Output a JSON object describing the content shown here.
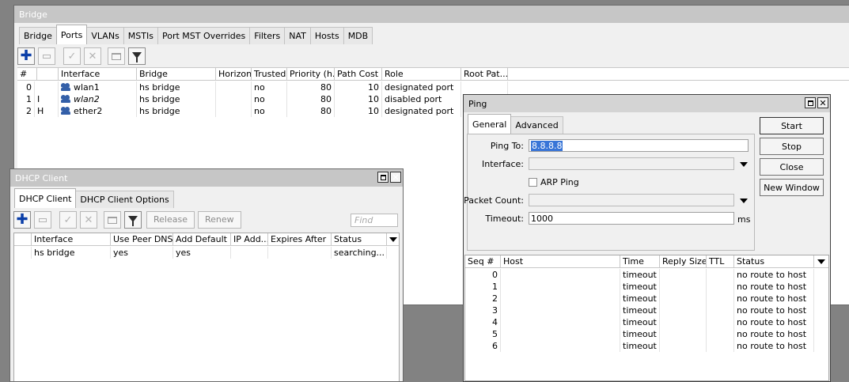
{
  "bridge_window": {
    "title": "Bridge",
    "tabs": [
      {
        "label": "Bridge"
      },
      {
        "label": "Ports"
      },
      {
        "label": "VLANs"
      },
      {
        "label": "MSTIs"
      },
      {
        "label": "Port MST Overrides"
      },
      {
        "label": "Filters"
      },
      {
        "label": "NAT"
      },
      {
        "label": "Hosts"
      },
      {
        "label": "MDB"
      }
    ],
    "selected_tab": "Ports",
    "toolbar": [
      {
        "icon": "plus-icon",
        "enabled": true
      },
      {
        "icon": "minus-icon",
        "enabled": false
      },
      {
        "icon": "check-icon",
        "enabled": false
      },
      {
        "icon": "cross-icon",
        "enabled": false
      },
      {
        "icon": "note-icon",
        "enabled": false
      },
      {
        "icon": "filter-icon",
        "enabled": true
      }
    ],
    "columns": [
      "#",
      "Interface",
      "Bridge",
      "Horizon",
      "Trusted",
      "Priority (h...",
      "Path Cost",
      "Role",
      "Root Pat..."
    ],
    "rows": [
      {
        "num": "0",
        "flag": "",
        "interface": "wlan1",
        "italic": false,
        "bridge": "hs bridge",
        "horizon": "",
        "trusted": "no",
        "priority": "80",
        "path_cost": "10",
        "role": "designated port",
        "root_path": ""
      },
      {
        "num": "1",
        "flag": "I",
        "interface": "wlan2",
        "italic": true,
        "bridge": "hs bridge",
        "horizon": "",
        "trusted": "no",
        "priority": "80",
        "path_cost": "10",
        "role": "disabled port",
        "root_path": ""
      },
      {
        "num": "2",
        "flag": "H",
        "interface": "ether2",
        "italic": false,
        "bridge": "hs bridge",
        "horizon": "",
        "trusted": "no",
        "priority": "80",
        "path_cost": "10",
        "role": "designated port",
        "root_path": ""
      }
    ]
  },
  "dhcp_window": {
    "title": "DHCP Client",
    "tabs": [
      {
        "label": "DHCP Client"
      },
      {
        "label": "DHCP Client Options"
      }
    ],
    "selected_tab": "DHCP Client",
    "buttons": {
      "release": "Release",
      "renew": "Renew"
    },
    "find_placeholder": "Find",
    "columns": [
      "Interface",
      "Use Peer DNS",
      "Add Default ...",
      "IP Add...",
      "Expires After",
      "Status"
    ],
    "rows": [
      {
        "interface": "hs bridge",
        "use_peer_dns": "yes",
        "add_default": "yes",
        "ip_address": "",
        "expires_after": "",
        "status": "searching..."
      }
    ]
  },
  "ping_window": {
    "title": "Ping",
    "tabs": [
      {
        "label": "General"
      },
      {
        "label": "Advanced"
      }
    ],
    "selected_tab": "General",
    "form": {
      "ping_to_label": "Ping To:",
      "ping_to_value": "8.8.8.8",
      "interface_label": "Interface:",
      "interface_value": "",
      "arp_ping_label": "ARP Ping",
      "arp_ping_checked": false,
      "packet_count_label": "Packet Count:",
      "packet_count_value": "",
      "timeout_label": "Timeout:",
      "timeout_value": "1000",
      "timeout_unit": "ms"
    },
    "buttons": {
      "start": "Start",
      "stop": "Stop",
      "close": "Close",
      "new_window": "New Window"
    },
    "columns": [
      "Seq #",
      "Host",
      "Time",
      "Reply Size",
      "TTL",
      "Status"
    ],
    "rows": [
      {
        "seq": "0",
        "host": "",
        "time": "timeout",
        "reply_size": "",
        "ttl": "",
        "status": "no route to host"
      },
      {
        "seq": "1",
        "host": "",
        "time": "timeout",
        "reply_size": "",
        "ttl": "",
        "status": "no route to host"
      },
      {
        "seq": "2",
        "host": "",
        "time": "timeout",
        "reply_size": "",
        "ttl": "",
        "status": "no route to host"
      },
      {
        "seq": "3",
        "host": "",
        "time": "timeout",
        "reply_size": "",
        "ttl": "",
        "status": "no route to host"
      },
      {
        "seq": "4",
        "host": "",
        "time": "timeout",
        "reply_size": "",
        "ttl": "",
        "status": "no route to host"
      },
      {
        "seq": "5",
        "host": "",
        "time": "timeout",
        "reply_size": "",
        "ttl": "",
        "status": "no route to host"
      },
      {
        "seq": "6",
        "host": "",
        "time": "timeout",
        "reply_size": "",
        "ttl": "",
        "status": "no route to host"
      }
    ]
  }
}
